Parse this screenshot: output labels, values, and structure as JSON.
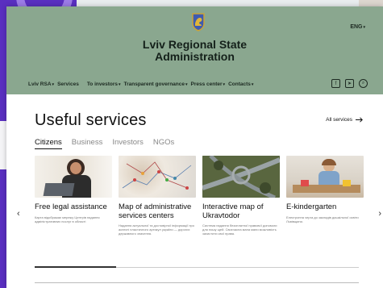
{
  "header": {
    "site_title_line1": "Lviv Regional State",
    "site_title_line2": "Administration",
    "language": "ENG",
    "emblem_icon": "lion-coat-of-arms-icon",
    "bg_color": "#8aa78f"
  },
  "nav": {
    "items": [
      {
        "label": "Lviv RSA",
        "dropdown": true
      },
      {
        "label": "Services",
        "dropdown": false
      },
      {
        "label": "To investors",
        "dropdown": true
      },
      {
        "label": "Transparent governance",
        "dropdown": true
      },
      {
        "label": "Press center",
        "dropdown": true
      },
      {
        "label": "Contacts",
        "dropdown": true
      }
    ],
    "icons": [
      "facebook-icon",
      "telegram-icon",
      "search-icon"
    ]
  },
  "services": {
    "title": "Useful services",
    "all_link": "All services",
    "tabs": [
      {
        "label": "Citizens",
        "active": true
      },
      {
        "label": "Business",
        "active": false
      },
      {
        "label": "Investors",
        "active": false
      },
      {
        "label": "NGOs",
        "active": false
      }
    ],
    "cards": [
      {
        "title": "Free legal assistance",
        "desc": "Карта відображає мережу Центрів надання адміністративних послуг в області"
      },
      {
        "title": "Map of administrative services centers",
        "desc": "Надання актуальної та достовірної інформації про аспекті пластичного артикул україни — дорогих державного значення."
      },
      {
        "title": "Interactive map of Ukravtodor",
        "desc": "Система надання безоплатної правової допомоги для пошу щей. Своєчасна мапа мани можливість захистити свої права."
      },
      {
        "title": "E-kindergarten",
        "desc": "Електронна черга до закладів дошкільної освіти Львівщини."
      }
    ],
    "progress_fraction": 0.25
  }
}
